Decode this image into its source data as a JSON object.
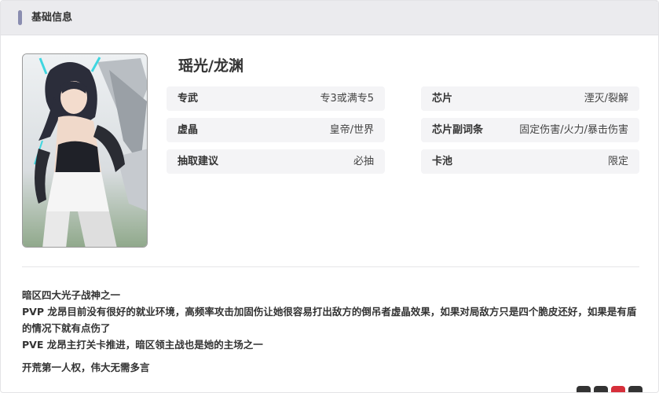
{
  "header": {
    "title": "基础信息"
  },
  "character": {
    "name": "瑶光/龙渊"
  },
  "info": {
    "left": [
      {
        "label": "专武",
        "value": "专3或满专5"
      },
      {
        "label": "虚晶",
        "value": "皇帝/世界"
      },
      {
        "label": "抽取建议",
        "value": "必抽"
      }
    ],
    "right": [
      {
        "label": "芯片",
        "value": "湮灭/裂解"
      },
      {
        "label": "芯片副词条",
        "value": "固定伤害/火力/暴击伤害"
      },
      {
        "label": "卡池",
        "value": "限定"
      }
    ]
  },
  "description": {
    "lines": [
      "暗区四大光子战神之一",
      "PVP 龙昂目前没有很好的就业环境，高频率攻击加固伤让她很容易打出敌方的倒吊者虚晶效果，如果对局敌方只是四个脆皮还好，如果是有盾的情况下就有点伤了",
      "PVE 龙昂主打关卡推进，暗区领主战也是她的主场之一"
    ],
    "footer": "开荒第一人权，伟大无需多言"
  },
  "colors": {
    "accent_bar": "#8a8db0",
    "header_bg": "#ebebee",
    "row_bg": "#f4f4f6",
    "icon_red": "#d62f3a"
  }
}
